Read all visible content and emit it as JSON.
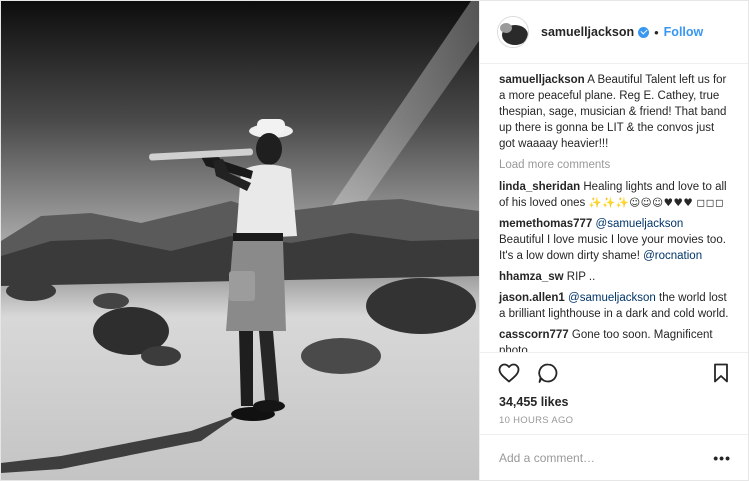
{
  "header": {
    "username": "samuelljackson",
    "separator": "•",
    "follow_label": "Follow"
  },
  "caption": {
    "username": "samuelljackson",
    "text": "A Beautiful Talent left us for a more peaceful plane. Reg E. Cathey, true thespian, sage, musician & friend! That band up there is gonna be LIT & the convos just got waaaay heavier!!!"
  },
  "load_more_label": "Load more comments",
  "comments": [
    {
      "username": "linda_sheridan",
      "text": "Healing lights and love to all of his loved ones",
      "emoji": "✨✨✨☺☺☺♥♥♥",
      "extra": "◻◻◻"
    },
    {
      "username": "memethomas777",
      "mention": "@samueljackson",
      "text": "Beautiful I love music I love your movies too. It's a low down dirty shame!",
      "mention2": "@rocnation"
    },
    {
      "username": "hhamza_sw",
      "text": "RIP .."
    },
    {
      "username": "jason.allen1",
      "mention": "@samueljackson",
      "text": "the world lost a brilliant lighthouse in a dark and cold world."
    },
    {
      "username": "casscorn777",
      "text": "Gone too soon. Magnificent photo."
    }
  ],
  "likes_label": "34,455 likes",
  "timestamp": "10 HOURS AGO",
  "add_comment_placeholder": "Add a comment…",
  "more_label": "•••",
  "colors": {
    "accent": "#3897f0",
    "muted": "#999999",
    "mention": "#003569",
    "border": "#efefef"
  }
}
